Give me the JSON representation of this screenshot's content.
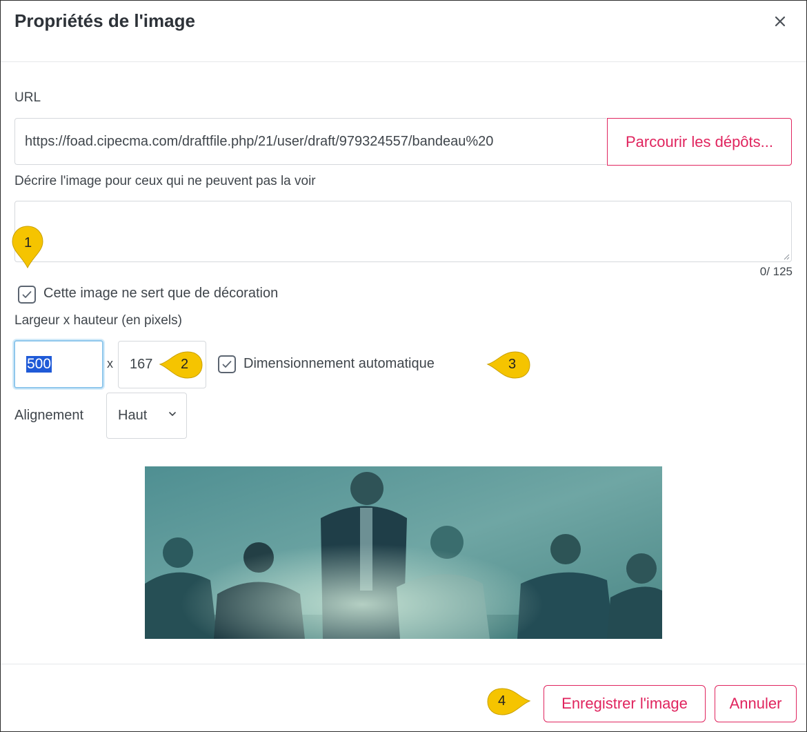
{
  "dialog": {
    "title": "Propriétés de l'image",
    "close_icon": "close-icon"
  },
  "url_field": {
    "label": "URL",
    "value": "https://foad.cipecma.com/draftfile.php/21/user/draft/979324557/bandeau%20",
    "browse_label": "Parcourir les dépôts..."
  },
  "alt_text": {
    "label": "Décrire l'image pour ceux qui ne peuvent pas la voir",
    "value": "",
    "counter": "0/ 125"
  },
  "decorative": {
    "label": "Cette image ne sert que de décoration",
    "checked": true
  },
  "size": {
    "label": "Largeur x hauteur (en pixels)",
    "width": "500",
    "separator": "x",
    "height": "167",
    "auto_label": "Dimensionnement automatique",
    "auto_checked": true
  },
  "alignment": {
    "label": "Alignement",
    "selected": "Haut"
  },
  "footer": {
    "save_label": "Enregistrer l'image",
    "cancel_label": "Annuler"
  },
  "callouts": [
    "1",
    "2",
    "3",
    "4"
  ],
  "colors": {
    "accent": "#e0245e",
    "callout": "#f5c400",
    "focus": "#8fc7ec",
    "selection": "#1f5ad7"
  }
}
